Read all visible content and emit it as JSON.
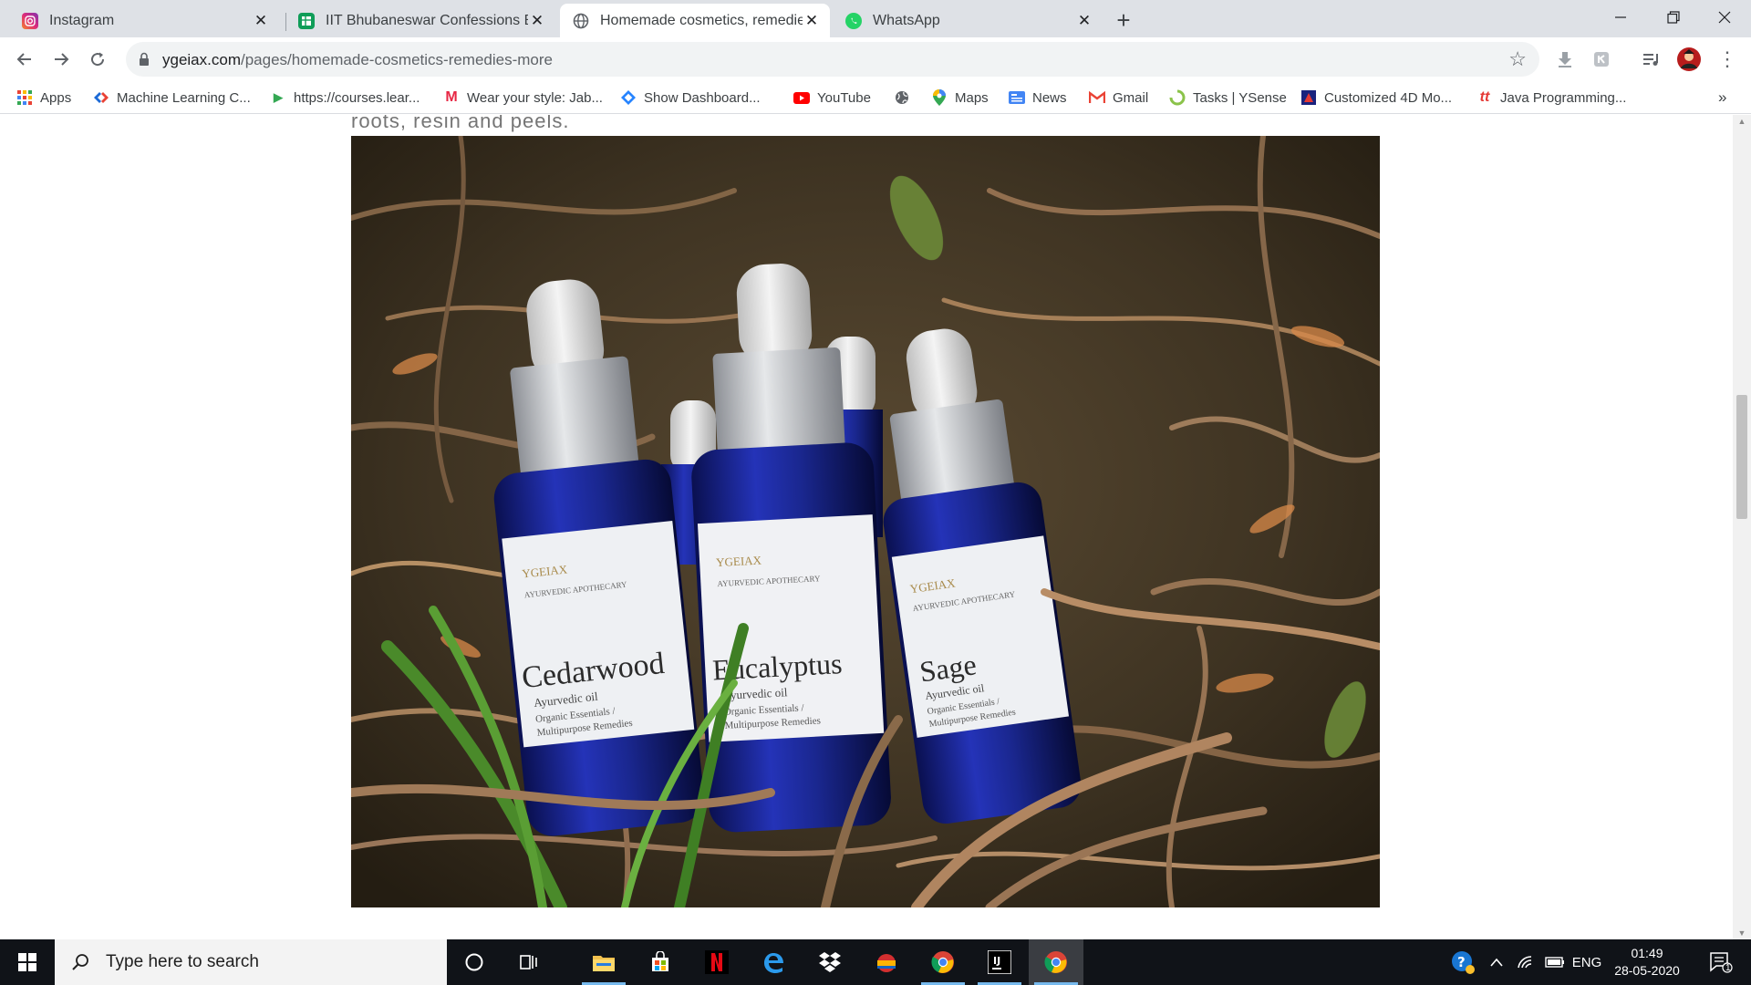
{
  "browser": {
    "tabs": [
      {
        "title": "Instagram",
        "icon": "instagram-icon",
        "color": "#d6249f",
        "active": false
      },
      {
        "title": "IIT Bhubaneswar Confessions Box",
        "icon": "sheets-icon",
        "color": "#0f9d58",
        "active": false
      },
      {
        "title": "Homemade cosmetics, remedies",
        "icon": "globe-icon",
        "color": "#5f6368",
        "active": true
      },
      {
        "title": "WhatsApp",
        "icon": "whatsapp-icon",
        "color": "#25d366",
        "active": false
      }
    ],
    "new_tab_label": "+",
    "url_domain": "ygeiax.com",
    "url_path": "/pages/homemade-cosmetics-remedies-more",
    "bookmarks": [
      {
        "label": "Apps",
        "icon": "apps-grid-icon"
      },
      {
        "label": "Machine Learning C...",
        "icon": "coursera-icon"
      },
      {
        "label": "https://courses.lear...",
        "icon": "course-play-icon"
      },
      {
        "label": "Wear your style: Jab...",
        "icon": "myntra-icon"
      },
      {
        "label": "Show Dashboard...",
        "icon": "dashboard-icon"
      },
      {
        "label": "YouTube",
        "icon": "youtube-icon"
      },
      {
        "label": "",
        "icon": "globe-icon"
      },
      {
        "label": "Maps",
        "icon": "maps-icon"
      },
      {
        "label": "News",
        "icon": "news-icon"
      },
      {
        "label": "Gmail",
        "icon": "gmail-icon"
      },
      {
        "label": "Tasks | YSense",
        "icon": "ysense-icon"
      },
      {
        "label": "Customized 4D Mo...",
        "icon": "model-icon"
      },
      {
        "label": "Java Programming...",
        "icon": "java-icon"
      }
    ],
    "bookmarks_overflow": "»"
  },
  "page": {
    "paragraph_tail": "roots, resin and peels.",
    "bottles": [
      {
        "brand": "YGEIAX",
        "subtitle": "AYURVEDIC APOTHECARY",
        "name": "Cedarwood",
        "line1": "Ayurvedic oil",
        "line2": "Organic Essentials /",
        "line3": "Multipurpose Remedies"
      },
      {
        "brand": "YGEIAX",
        "subtitle": "AYURVEDIC APOTHECARY",
        "name": "Eucalyptus",
        "line1": "Ayurvedic oil",
        "line2": "Organic Essentials /",
        "line3": "Multipurpose Remedies"
      },
      {
        "brand": "YGEIAX",
        "subtitle": "AYURVEDIC APOTHECARY",
        "name": "Sage",
        "line1": "Ayurvedic oil",
        "line2": "Organic Essentials /",
        "line3": "Multipurpose Remedies"
      }
    ]
  },
  "taskbar": {
    "search_placeholder": "Type here to search",
    "apps": [
      "cortana-icon",
      "task-view-icon",
      "file-explorer-icon",
      "store-icon",
      "netflix-icon",
      "edge-icon",
      "dropbox-icon",
      "app-icon",
      "chrome-icon",
      "intellij-icon",
      "chrome-canary-icon"
    ],
    "language": "ENG",
    "time": "01:49",
    "date": "28-05-2020",
    "notification_count": "1"
  },
  "colors": {
    "tab_strip": "#dee1e6",
    "taskbar": "#101318",
    "bottle_glass": "#1c2a8c",
    "bottle_cap": "#c9ccd0"
  }
}
